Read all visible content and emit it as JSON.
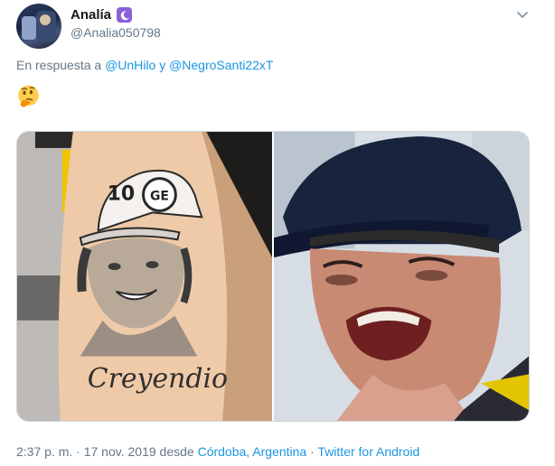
{
  "tweet": {
    "display_name": "Analía",
    "handle": "@Analia050798",
    "reply_prefix": "En respuesta a",
    "reply_user1": "@UnHilo",
    "reply_joiner": "y",
    "reply_user2": "@NegroSanti22xT",
    "emoji_name": "thinking-face",
    "media": {
      "left_image_text": {
        "cap_number": "10",
        "tattoo_script": "Creyendio"
      }
    },
    "footer": {
      "time": "2:37 p. m.",
      "sep1": "·",
      "date": "17 nov. 2019",
      "desde": "desde",
      "location": "Córdoba, Argentina",
      "sep2": "·",
      "client": "Twitter for Android"
    }
  },
  "colors": {
    "link": "#1b95e0",
    "secondary_text": "#657786",
    "badge": "#8a62d6"
  }
}
